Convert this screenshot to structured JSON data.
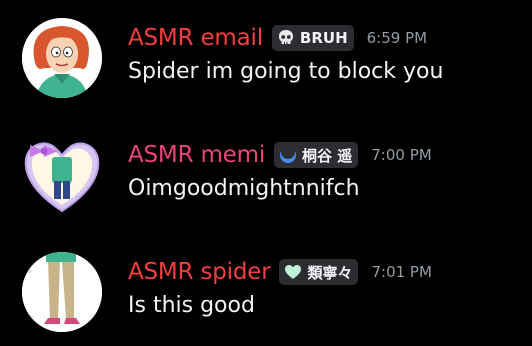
{
  "messages": [
    {
      "username": "ASMR email",
      "username_color": "#f23f42",
      "tag": {
        "icon": "skull-icon",
        "text": "BRUH"
      },
      "timestamp": "6:59 PM",
      "content": "Spider im going to block you",
      "avatar": "lois-avatar"
    },
    {
      "username": "ASMR memi",
      "username_color": "#e9457a",
      "tag": {
        "icon": "moon-icon",
        "text": "桐谷 遥"
      },
      "timestamp": "7:00 PM",
      "content": "Oimgoodmightnnifch",
      "avatar": "heart-frame-avatar"
    },
    {
      "username": "ASMR spider",
      "username_color": "#f23f42",
      "tag": {
        "icon": "heart-icon",
        "text": "類寧々"
      },
      "timestamp": "7:01 PM",
      "content": "Is this good",
      "avatar": "legs-avatar"
    }
  ]
}
